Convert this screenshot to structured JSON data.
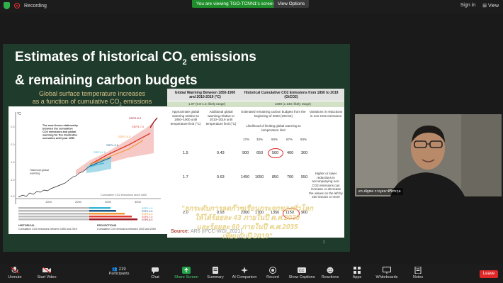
{
  "topbar": {
    "recording": "Recording",
    "banner": "You are viewing TGO-TCNN1's screen",
    "view_options": "View Options",
    "sign_in": "Sign in",
    "view": "View"
  },
  "slide": {
    "title_line1_a": "Estimates of historical CO",
    "title_sub": "2",
    "title_line1_b": " emissions",
    "title_line2": "& remaining carbon budgets",
    "subtitle_line1": "Global surface temperature increases",
    "subtitle_line2_a": "as a function of cumulative CO",
    "subtitle_line2_b": " emissions",
    "source_label": "Source:",
    "source_text": "AR6 (IPCC-WGI, 2021)",
    "thai_line1": "\"ยกระดับการลดก๊าซเรือนกระจกของทั่วโลก",
    "thai_line2": "ให้ได้ร้อยละ 43 ภายในปี ค.ศ.2030",
    "thai_line3": "และร้อยละ 60 ภายในปี ค.ศ.2035",
    "thai_line4": "เทียบกับปี 2019\"",
    "page": "2"
  },
  "table": {
    "h_col1": "Global Warming Between 1850-1900 and 2010-2019 (°C)",
    "h_col2": "Historical Cumulative CO2 Emissions from 1850 to 2019 (GtCO2)",
    "sub1": "1.07 (0.8-1.3; likely range)",
    "sub2": "2390 (± 240; likely range)",
    "hdr_a": "Approximate global warming relative to 1850–1900 until temperature limit (°C)",
    "hdr_b": "Additional global warming relative to 2010–2019 until temperature limit (°C)",
    "hdr_c": "Estimated remaining carbon budgets from the beginning of 2020 (GtCO2)",
    "hdr_c2": "Likelihood of limiting global warming to temperature limit",
    "hdr_d": "Variations in reductions in non-CO2 emissions",
    "pcts": [
      "17%",
      "33%",
      "50%",
      "67%",
      "83%"
    ],
    "rows": [
      {
        "a": "1.5",
        "b": "0.43",
        "v": [
          "900",
          "650",
          "500",
          "400",
          "300"
        ]
      },
      {
        "a": "1.7",
        "b": "0.63",
        "v": [
          "1450",
          "1050",
          "850",
          "700",
          "550"
        ]
      },
      {
        "a": "2.0",
        "b": "0.93",
        "v": [
          "2300",
          "1700",
          "1350",
          "1150",
          "900"
        ]
      }
    ],
    "variation_note": "Higher or lower reductions in accompanying non-CO2 emissions can increase or decrease the values on the left by 220 GtCO2 or more"
  },
  "chart": {
    "ylabel": "°C",
    "annot": "The near-linear relationship between the cumulative CO2 emissions and global warming for five illustrative scenarios until year 2050",
    "hist": "Historical global warming",
    "xcaption": "Cumulative CO2 emissions since 1850",
    "scenarios": [
      "SSP5-8.5",
      "SSP3-7.0",
      "SSP2-4.5",
      "SSP1-2.6",
      "SSP1-1.9"
    ],
    "xticks": [
      "1000",
      "2000",
      "3000",
      "4000"
    ],
    "footer_left": "HISTORICAL",
    "footer_left2": "Cumulative CO2 emissions between 1850 and 2019",
    "footer_right": "PROJECTIONS",
    "footer_right2": "Cumulative CO2 emissions between 2020 and 2050",
    "colors": {
      "ssp585": "#9e1b28",
      "ssp370": "#e03a2f",
      "ssp245": "#f29a36",
      "ssp126": "#1b5a8a",
      "ssp119": "#3ab6d6"
    }
  },
  "video": {
    "name": "ดร.ณัฐพล กาญจนาศิริศรกุล"
  },
  "bottombar": {
    "items": [
      "Unmute",
      "Start Video",
      "Participants",
      "Chat",
      "Share Screen",
      "Summary",
      "AI Companion",
      "Record",
      "Show Captions",
      "Reactions",
      "Apps",
      "Whiteboards",
      "Notes"
    ],
    "participants_count": "219",
    "leave": "Leave"
  }
}
